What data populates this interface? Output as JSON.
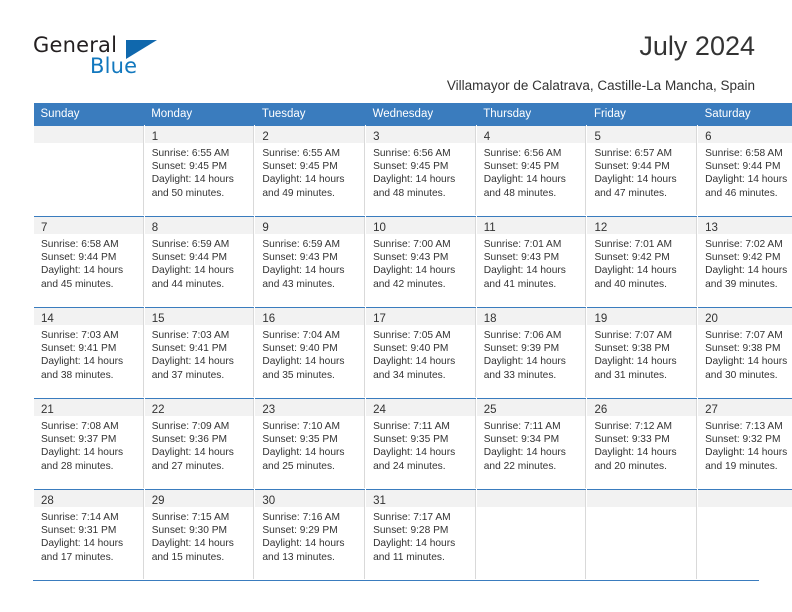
{
  "brand": {
    "name_part1": "General",
    "name_part2": "Blue",
    "triangle_icon": "blue-triangle-icon",
    "accent_color": "#1068ad"
  },
  "header": {
    "title": "July 2024",
    "subtitle": "Villamayor de Calatrava, Castille-La Mancha, Spain"
  },
  "calendar": {
    "header_bg": "#3a7cbe",
    "daynum_band_bg": "#f2f2f2",
    "weekday_headers": [
      "Sunday",
      "Monday",
      "Tuesday",
      "Wednesday",
      "Thursday",
      "Friday",
      "Saturday"
    ],
    "weeks": [
      [
        {
          "day": "",
          "lines": []
        },
        {
          "day": "1",
          "lines": [
            "Sunrise: 6:55 AM",
            "Sunset: 9:45 PM",
            "Daylight: 14 hours",
            "and 50 minutes."
          ]
        },
        {
          "day": "2",
          "lines": [
            "Sunrise: 6:55 AM",
            "Sunset: 9:45 PM",
            "Daylight: 14 hours",
            "and 49 minutes."
          ]
        },
        {
          "day": "3",
          "lines": [
            "Sunrise: 6:56 AM",
            "Sunset: 9:45 PM",
            "Daylight: 14 hours",
            "and 48 minutes."
          ]
        },
        {
          "day": "4",
          "lines": [
            "Sunrise: 6:56 AM",
            "Sunset: 9:45 PM",
            "Daylight: 14 hours",
            "and 48 minutes."
          ]
        },
        {
          "day": "5",
          "lines": [
            "Sunrise: 6:57 AM",
            "Sunset: 9:44 PM",
            "Daylight: 14 hours",
            "and 47 minutes."
          ]
        },
        {
          "day": "6",
          "lines": [
            "Sunrise: 6:58 AM",
            "Sunset: 9:44 PM",
            "Daylight: 14 hours",
            "and 46 minutes."
          ]
        }
      ],
      [
        {
          "day": "7",
          "lines": [
            "Sunrise: 6:58 AM",
            "Sunset: 9:44 PM",
            "Daylight: 14 hours",
            "and 45 minutes."
          ]
        },
        {
          "day": "8",
          "lines": [
            "Sunrise: 6:59 AM",
            "Sunset: 9:44 PM",
            "Daylight: 14 hours",
            "and 44 minutes."
          ]
        },
        {
          "day": "9",
          "lines": [
            "Sunrise: 6:59 AM",
            "Sunset: 9:43 PM",
            "Daylight: 14 hours",
            "and 43 minutes."
          ]
        },
        {
          "day": "10",
          "lines": [
            "Sunrise: 7:00 AM",
            "Sunset: 9:43 PM",
            "Daylight: 14 hours",
            "and 42 minutes."
          ]
        },
        {
          "day": "11",
          "lines": [
            "Sunrise: 7:01 AM",
            "Sunset: 9:43 PM",
            "Daylight: 14 hours",
            "and 41 minutes."
          ]
        },
        {
          "day": "12",
          "lines": [
            "Sunrise: 7:01 AM",
            "Sunset: 9:42 PM",
            "Daylight: 14 hours",
            "and 40 minutes."
          ]
        },
        {
          "day": "13",
          "lines": [
            "Sunrise: 7:02 AM",
            "Sunset: 9:42 PM",
            "Daylight: 14 hours",
            "and 39 minutes."
          ]
        }
      ],
      [
        {
          "day": "14",
          "lines": [
            "Sunrise: 7:03 AM",
            "Sunset: 9:41 PM",
            "Daylight: 14 hours",
            "and 38 minutes."
          ]
        },
        {
          "day": "15",
          "lines": [
            "Sunrise: 7:03 AM",
            "Sunset: 9:41 PM",
            "Daylight: 14 hours",
            "and 37 minutes."
          ]
        },
        {
          "day": "16",
          "lines": [
            "Sunrise: 7:04 AM",
            "Sunset: 9:40 PM",
            "Daylight: 14 hours",
            "and 35 minutes."
          ]
        },
        {
          "day": "17",
          "lines": [
            "Sunrise: 7:05 AM",
            "Sunset: 9:40 PM",
            "Daylight: 14 hours",
            "and 34 minutes."
          ]
        },
        {
          "day": "18",
          "lines": [
            "Sunrise: 7:06 AM",
            "Sunset: 9:39 PM",
            "Daylight: 14 hours",
            "and 33 minutes."
          ]
        },
        {
          "day": "19",
          "lines": [
            "Sunrise: 7:07 AM",
            "Sunset: 9:38 PM",
            "Daylight: 14 hours",
            "and 31 minutes."
          ]
        },
        {
          "day": "20",
          "lines": [
            "Sunrise: 7:07 AM",
            "Sunset: 9:38 PM",
            "Daylight: 14 hours",
            "and 30 minutes."
          ]
        }
      ],
      [
        {
          "day": "21",
          "lines": [
            "Sunrise: 7:08 AM",
            "Sunset: 9:37 PM",
            "Daylight: 14 hours",
            "and 28 minutes."
          ]
        },
        {
          "day": "22",
          "lines": [
            "Sunrise: 7:09 AM",
            "Sunset: 9:36 PM",
            "Daylight: 14 hours",
            "and 27 minutes."
          ]
        },
        {
          "day": "23",
          "lines": [
            "Sunrise: 7:10 AM",
            "Sunset: 9:35 PM",
            "Daylight: 14 hours",
            "and 25 minutes."
          ]
        },
        {
          "day": "24",
          "lines": [
            "Sunrise: 7:11 AM",
            "Sunset: 9:35 PM",
            "Daylight: 14 hours",
            "and 24 minutes."
          ]
        },
        {
          "day": "25",
          "lines": [
            "Sunrise: 7:11 AM",
            "Sunset: 9:34 PM",
            "Daylight: 14 hours",
            "and 22 minutes."
          ]
        },
        {
          "day": "26",
          "lines": [
            "Sunrise: 7:12 AM",
            "Sunset: 9:33 PM",
            "Daylight: 14 hours",
            "and 20 minutes."
          ]
        },
        {
          "day": "27",
          "lines": [
            "Sunrise: 7:13 AM",
            "Sunset: 9:32 PM",
            "Daylight: 14 hours",
            "and 19 minutes."
          ]
        }
      ],
      [
        {
          "day": "28",
          "lines": [
            "Sunrise: 7:14 AM",
            "Sunset: 9:31 PM",
            "Daylight: 14 hours",
            "and 17 minutes."
          ]
        },
        {
          "day": "29",
          "lines": [
            "Sunrise: 7:15 AM",
            "Sunset: 9:30 PM",
            "Daylight: 14 hours",
            "and 15 minutes."
          ]
        },
        {
          "day": "30",
          "lines": [
            "Sunrise: 7:16 AM",
            "Sunset: 9:29 PM",
            "Daylight: 14 hours",
            "and 13 minutes."
          ]
        },
        {
          "day": "31",
          "lines": [
            "Sunrise: 7:17 AM",
            "Sunset: 9:28 PM",
            "Daylight: 14 hours",
            "and 11 minutes."
          ]
        },
        {
          "day": "",
          "lines": []
        },
        {
          "day": "",
          "lines": []
        },
        {
          "day": "",
          "lines": []
        }
      ]
    ]
  }
}
